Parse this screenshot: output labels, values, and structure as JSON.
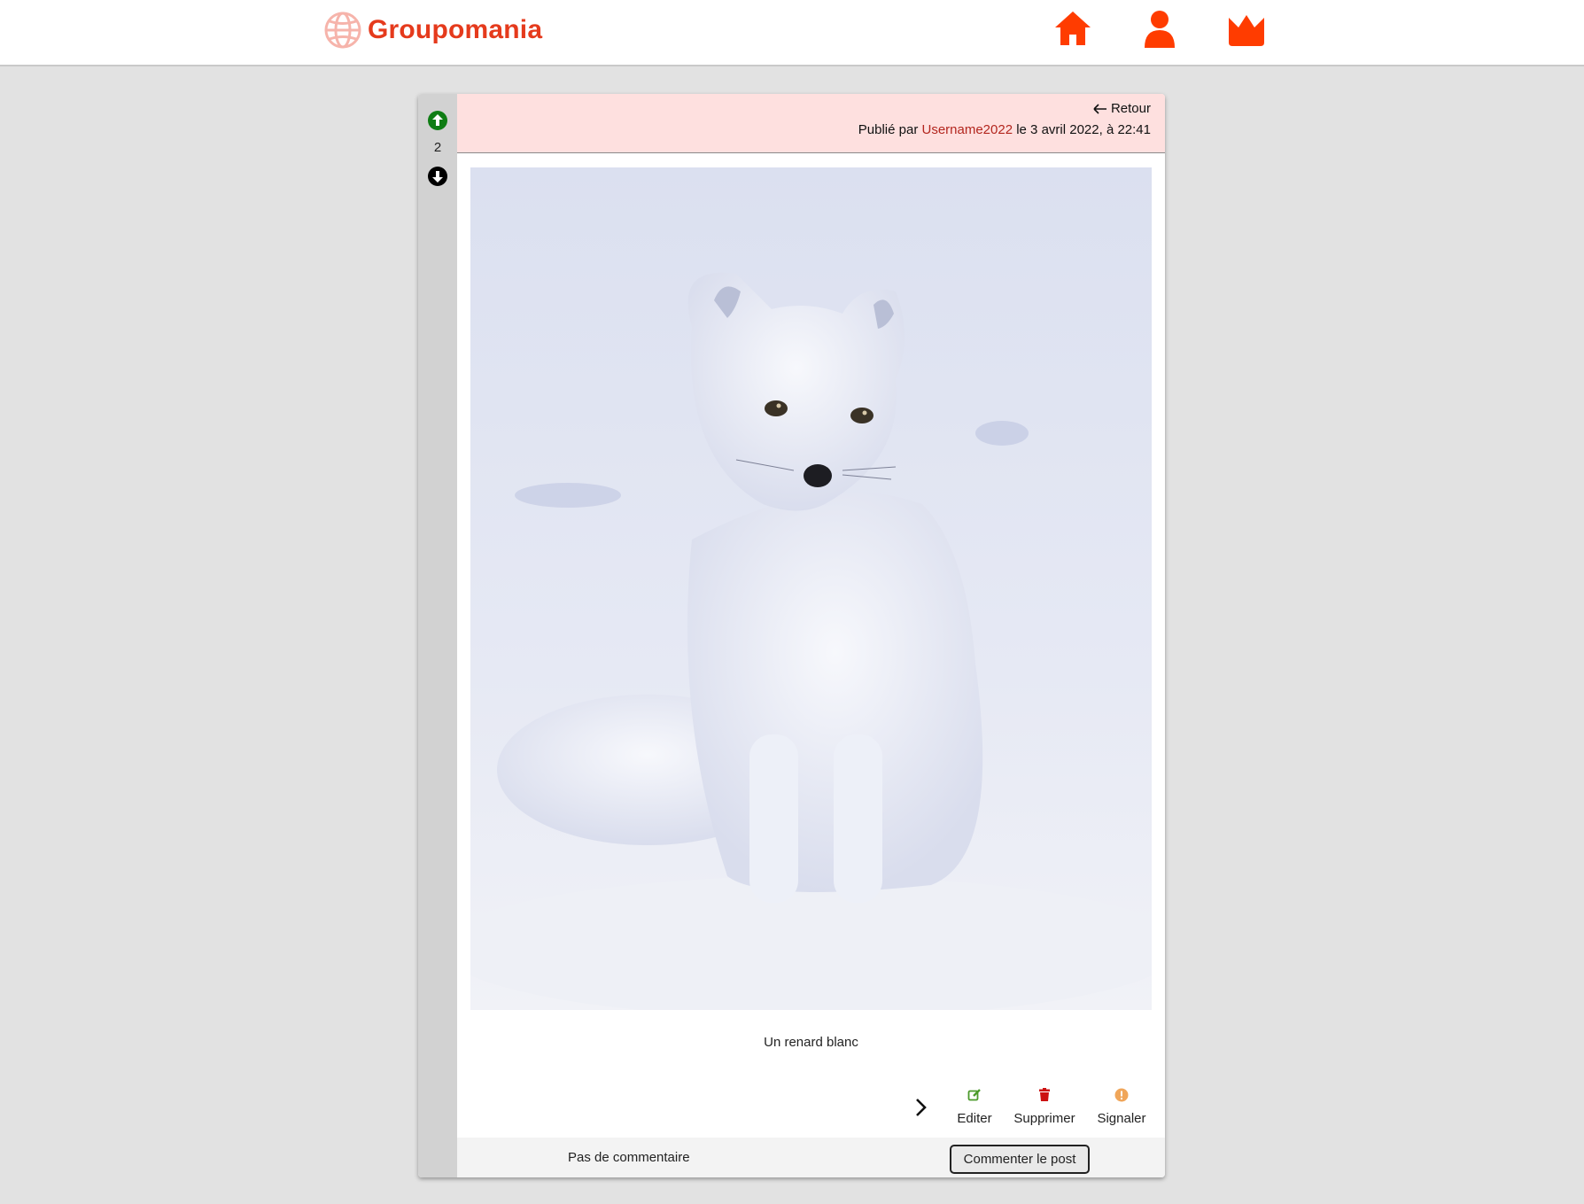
{
  "header": {
    "brand_name": "Groupomania",
    "accent_color": "#e53a1c",
    "nav_icons": [
      "home-icon",
      "user-icon",
      "crown-icon"
    ]
  },
  "post": {
    "score": "2",
    "back_label": "Retour",
    "published_prefix": "Publié par",
    "author": "Username2022",
    "published_suffix": "le 3 avril 2022, à 22:41",
    "image_icon": "arctic-fox-photo",
    "caption": "Un renard blanc",
    "actions": {
      "edit_label": "Editer",
      "delete_label": "Supprimer",
      "report_label": "Signaler"
    },
    "comments_status": "Pas de commentaire",
    "comment_button_label": "Commenter le post"
  }
}
